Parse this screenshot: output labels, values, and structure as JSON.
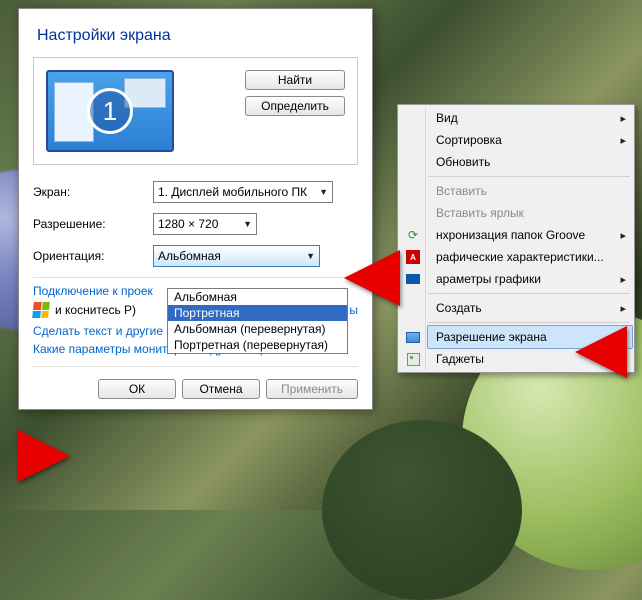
{
  "dialog": {
    "title": "Настройки экрана",
    "monitor_number": "1",
    "find_button": "Найти",
    "identify_button": "Определить",
    "screen_label": "Экран:",
    "screen_value": "1. Дисплей мобильного ПК",
    "resolution_label": "Разрешение:",
    "resolution_value": "1280 × 720",
    "orientation_label": "Ориентация:",
    "orientation_value": "Альбомная",
    "orientation_options": [
      "Альбомная",
      "Портретная",
      "Альбомная (перевернутая)",
      "Портретная (перевернутая)"
    ],
    "orientation_selected_index": 1,
    "projector_link": "Подключение к проек",
    "projector_hint": "и коснитесь P)",
    "projector_trailing": "ы",
    "text_size_link": "Сделать текст и другие элементы больше или меньше",
    "monitor_params_link": "Какие параметры монитора следует выбрать?",
    "ok_button": "ОК",
    "cancel_button": "Отмена",
    "apply_button": "Применить"
  },
  "context_menu": {
    "items": [
      {
        "label": "Вид",
        "submenu": true
      },
      {
        "label": "Сортировка",
        "submenu": true
      },
      {
        "label": "Обновить"
      },
      {
        "sep": true
      },
      {
        "label": "Вставить",
        "disabled": true
      },
      {
        "label": "Вставить ярлык",
        "disabled": true
      },
      {
        "label": "нхронизация папок Groove",
        "submenu": true,
        "icon": "groove"
      },
      {
        "label": "рафические характеристики...",
        "icon": "amd"
      },
      {
        "label": "араметры графики",
        "submenu": true,
        "icon": "intel"
      },
      {
        "sep": true
      },
      {
        "label": "Создать",
        "submenu": true
      },
      {
        "sep": true
      },
      {
        "label": "Разрешение экрана",
        "icon": "screen",
        "hover": true
      },
      {
        "label": "Гаджеты",
        "icon": "gadget"
      }
    ]
  }
}
